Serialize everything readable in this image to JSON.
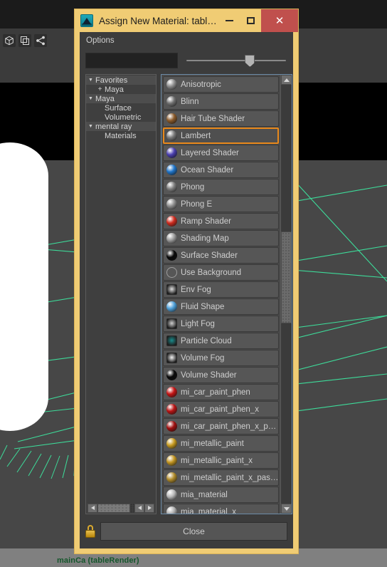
{
  "viewport": {
    "toolbar_icons": [
      "cube-icon",
      "duplicate-icon",
      "share-node-icon"
    ],
    "status_text": "mainCa (tableRender)",
    "status_color": "#14562b",
    "grid_color": "#3ddc9a"
  },
  "dialog": {
    "title": "Assign New Material: tabl…",
    "app_icon": "maya-app-icon",
    "frame_color": "#f0cc74",
    "window_buttons": {
      "minimize": "−",
      "maximize": "□",
      "close": "✕",
      "close_color": "#c0504d"
    },
    "menubar": [
      {
        "label": "Options"
      }
    ],
    "name_field": {
      "value": "",
      "placeholder": ""
    },
    "slider": {
      "value": 58
    },
    "tree": {
      "nodes": [
        {
          "label": "Favorites",
          "type": "group",
          "arrow": "▼",
          "indent": 0
        },
        {
          "label": "Maya",
          "type": "plus",
          "arrow": "+",
          "indent": 1
        },
        {
          "label": "Maya",
          "type": "group",
          "arrow": "▼",
          "indent": 0
        },
        {
          "label": "Surface",
          "type": "leaf",
          "arrow": "",
          "indent": 1
        },
        {
          "label": "Volumetric",
          "type": "leaf",
          "arrow": "",
          "indent": 1
        },
        {
          "label": "mental ray",
          "type": "group",
          "arrow": "▼",
          "indent": 0
        },
        {
          "label": "Materials",
          "type": "leaf",
          "arrow": "",
          "indent": 1
        }
      ],
      "hscroll": {
        "left_arrow": "◀",
        "prev_arrow": "◀",
        "next_arrow": "▶"
      }
    },
    "materials": {
      "selected": "Lambert",
      "selection_color": "#e8881a",
      "items": [
        {
          "label": "Anisotropic",
          "swatch": "#8d8d8d",
          "shape": "sphere"
        },
        {
          "label": "Blinn",
          "swatch": "#6f6f6f",
          "shape": "sphere"
        },
        {
          "label": "Hair Tube Shader",
          "swatch": "#8a5a2a",
          "shape": "sphere"
        },
        {
          "label": "Lambert",
          "swatch": "#787878",
          "shape": "sphere"
        },
        {
          "label": "Layered Shader",
          "swatch": "#4a3fb0",
          "shape": "sphere"
        },
        {
          "label": "Ocean Shader",
          "swatch": "#1f74c8",
          "shape": "sphere"
        },
        {
          "label": "Phong",
          "swatch": "#7d7d7d",
          "shape": "sphere"
        },
        {
          "label": "Phong E",
          "swatch": "#8f8f8f",
          "shape": "sphere"
        },
        {
          "label": "Ramp Shader",
          "swatch": "#cf2b1e",
          "shape": "sphere"
        },
        {
          "label": "Shading Map",
          "swatch": "#9a9a9a",
          "shape": "sphere"
        },
        {
          "label": "Surface Shader",
          "swatch": "#080808",
          "shape": "sphere"
        },
        {
          "label": "Use Background",
          "swatch": "#9e9e9e",
          "shape": "circle-outline"
        },
        {
          "label": "Env Fog",
          "swatch": "#dedede",
          "shape": "square"
        },
        {
          "label": "Fluid Shape",
          "swatch": "#4d9fd8",
          "shape": "sphere"
        },
        {
          "label": "Light Fog",
          "swatch": "#cfcfcf",
          "shape": "square"
        },
        {
          "label": "Particle Cloud",
          "swatch": "#1a8c8c",
          "shape": "square"
        },
        {
          "label": "Volume Fog",
          "swatch": "#f2f2f2",
          "shape": "square"
        },
        {
          "label": "Volume Shader",
          "swatch": "#0a0a0a",
          "shape": "sphere"
        },
        {
          "label": "mi_car_paint_phen",
          "swatch": "#c41414",
          "shape": "sphere"
        },
        {
          "label": "mi_car_paint_phen_x",
          "swatch": "#b81414",
          "shape": "sphere"
        },
        {
          "label": "mi_car_paint_phen_x_p…",
          "swatch": "#a01010",
          "shape": "sphere"
        },
        {
          "label": "mi_metallic_paint",
          "swatch": "#c79b20",
          "shape": "sphere"
        },
        {
          "label": "mi_metallic_paint_x",
          "swatch": "#c19420",
          "shape": "sphere"
        },
        {
          "label": "mi_metallic_paint_x_pas…",
          "swatch": "#b08b2a",
          "shape": "sphere"
        },
        {
          "label": "mia_material",
          "swatch": "#b8b8b8",
          "shape": "sphere"
        },
        {
          "label": "mia_material_x",
          "swatch": "#b0b0b0",
          "shape": "sphere"
        }
      ]
    },
    "footer": {
      "lock_icon": "lock-icon",
      "close_label": "Close"
    }
  }
}
